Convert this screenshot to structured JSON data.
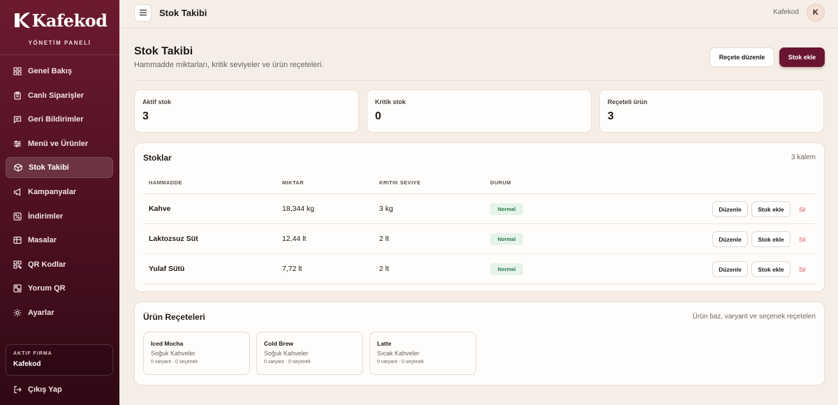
{
  "sidebar": {
    "brand_name": "Kafekod",
    "brand_subtitle": "YÖNETİM PANELİ",
    "items": [
      {
        "label": "Genel Bakış",
        "icon": "grid-icon"
      },
      {
        "label": "Canlı Siparişler",
        "icon": "clipboard-icon"
      },
      {
        "label": "Geri Bildirimler",
        "icon": "chat-icon"
      },
      {
        "label": "Menü ve Ürünler",
        "icon": "sliders-icon"
      },
      {
        "label": "Stok Takibi",
        "icon": "box-icon",
        "active": true
      },
      {
        "label": "Kampanyalar",
        "icon": "megaphone-icon"
      },
      {
        "label": "İndirimler",
        "icon": "percent-icon"
      },
      {
        "label": "Masalar",
        "icon": "table-icon"
      },
      {
        "label": "QR Kodlar",
        "icon": "qr-icon"
      },
      {
        "label": "Yorum QR",
        "icon": "qr-comment-icon"
      },
      {
        "label": "Ayarlar",
        "icon": "gear-icon"
      }
    ],
    "firm_label": "AKTIF FIRMA",
    "firm_name": "Kafekod",
    "logout_label": "Çıkış Yap"
  },
  "topbar": {
    "title": "Stok Takibi",
    "user_name": "Kafekod",
    "avatar_initial": "K"
  },
  "header": {
    "title": "Stok Takibi",
    "subtitle": "Hammadde miktarları, kritik seviyeler ve ürün reçeteleri.",
    "recipe_edit_label": "Reçete düzenle",
    "add_stock_label": "Stok ekle"
  },
  "stats": [
    {
      "label": "Aktif stok",
      "value": "3"
    },
    {
      "label": "Kritik stok",
      "value": "0"
    },
    {
      "label": "Reçeteli ürün",
      "value": "3"
    }
  ],
  "stocks": {
    "title": "Stoklar",
    "count": "3 kalem",
    "columns": [
      "HAMMADDE",
      "MIKTAR",
      "KRITIK SEVIYE",
      "DURUM"
    ],
    "rows": [
      {
        "name": "Kahve",
        "amount": "18,344 kg",
        "critical": "3 kg",
        "status": "Normal"
      },
      {
        "name": "Laktozsuz Süt",
        "amount": "12,44 lt",
        "critical": "2 lt",
        "status": "Normal"
      },
      {
        "name": "Yulaf Sütü",
        "amount": "7,72 lt",
        "critical": "2 lt",
        "status": "Normal"
      }
    ],
    "edit_label": "Düzenle",
    "add_label": "Stok ekle",
    "delete_label": "Sil"
  },
  "recipes": {
    "title": "Ürün Reçeteleri",
    "description": "Ürün baz, varyant ve seçenek reçeteleri",
    "items": [
      {
        "name": "Iced Mocha",
        "category": "Soğuk Kahveler",
        "meta": "0 varyant · 0 seçenek"
      },
      {
        "name": "Cold Brew",
        "category": "Soğuk Kahveler",
        "meta": "0 varyant · 0 seçenek"
      },
      {
        "name": "Latte",
        "category": "Sıcak Kahveler",
        "meta": "0 varyant · 0 seçenek"
      }
    ]
  },
  "colors": {
    "brand": "#6a1530",
    "status_normal_bg": "#e5f3ea",
    "status_normal_text": "#2c7a4b",
    "danger": "#d24a5a"
  }
}
